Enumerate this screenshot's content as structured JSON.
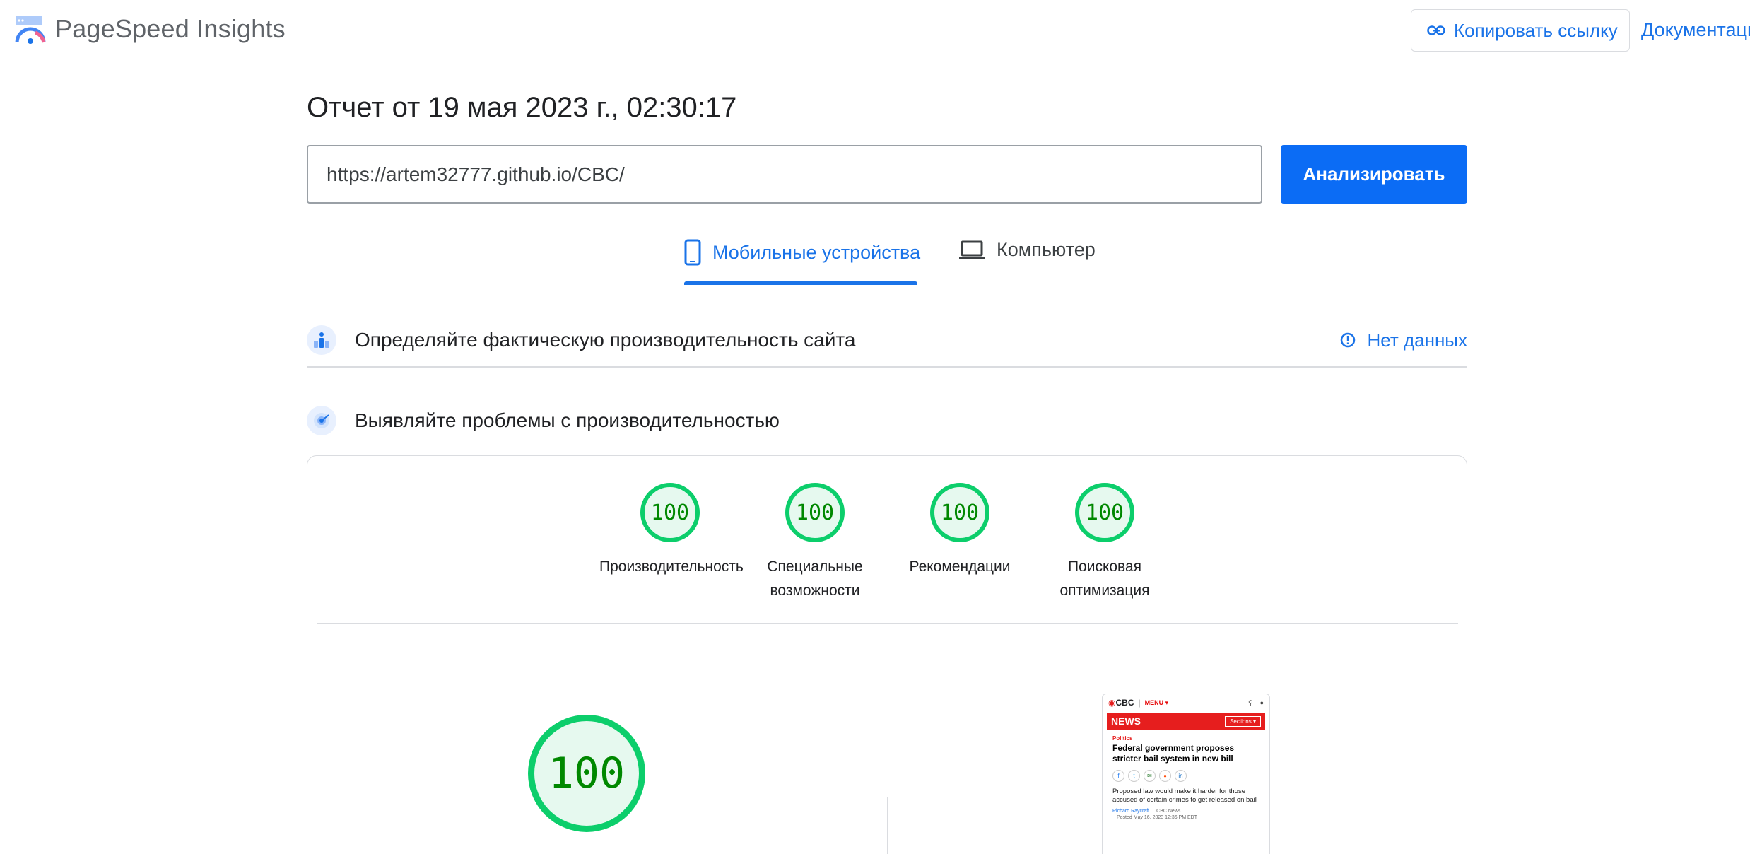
{
  "header": {
    "brand": "PageSpeed Insights",
    "copy_link_label": "Копировать ссылку",
    "docs_label": "Документаци"
  },
  "report": {
    "title": "Отчет от 19 мая 2023 г., 02:30:17"
  },
  "search": {
    "url_value": "https://artem32777.github.io/CBC/",
    "analyze_label": "Анализировать"
  },
  "tabs": [
    {
      "label": "Мобильные устройства",
      "active": true,
      "icon": "smartphone-icon"
    },
    {
      "label": "Компьютер",
      "active": false,
      "icon": "laptop-icon"
    }
  ],
  "sections": {
    "field_data": {
      "title": "Определяйте фактическую производительность сайта",
      "status_label": "Нет данных"
    },
    "lab_data": {
      "title": "Выявляйте проблемы с производительностью"
    }
  },
  "scores": [
    {
      "value": "100",
      "label_line1": "Производительность",
      "label_line2": ""
    },
    {
      "value": "100",
      "label_line1": "Специальные",
      "label_line2": "возможности"
    },
    {
      "value": "100",
      "label_line1": "Рекомендации",
      "label_line2": ""
    },
    {
      "value": "100",
      "label_line1": "Поисковая",
      "label_line2": "оптимизация"
    }
  ],
  "main_score": "100",
  "thumbnail": {
    "brand": "CBC",
    "menu": "MENU",
    "news": "NEWS",
    "sections": "Sections",
    "category": "Politics",
    "headline": "Federal government proposes stricter bail system in new bill",
    "summary": "Proposed law would make it harder for those accused of certain crimes to get released on bail",
    "author": "Richard Raycraft",
    "outlet": "CBC News",
    "posted": "Posted May 16, 2023 12:36 PM EDT"
  },
  "colors": {
    "accent": "#1a73e8",
    "button": "#0b6cf5",
    "score_good": "#0cce6b",
    "score_text": "#008800",
    "cbc_red": "#e61e1e"
  }
}
